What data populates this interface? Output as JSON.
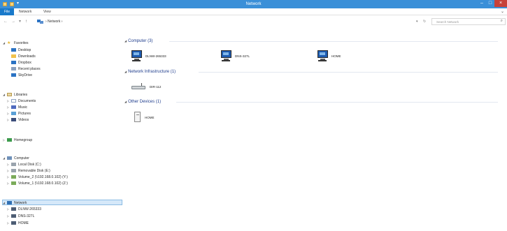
{
  "window": {
    "title": "Network",
    "qat": [
      "▾"
    ],
    "controls": {
      "minimize": "–",
      "maximize": "□",
      "close": "×"
    }
  },
  "ribbon": {
    "tabs": [
      {
        "label": "File"
      },
      {
        "label": "Network"
      },
      {
        "label": "View"
      }
    ],
    "expand": "⌄"
  },
  "addressbar": {
    "back": "←",
    "forward": "→",
    "recent": "▾",
    "up": "↑",
    "breadcrumb": "› Network ›",
    "dropdown": "▾",
    "refresh": "↻",
    "search_placeholder": "Search Network",
    "search_icon": "⌕"
  },
  "navpane": {
    "items": [
      {
        "label": "Favorites",
        "arrow": "◢",
        "icon": "star-icon"
      },
      {
        "label": "Desktop",
        "icon": "desktop-icon"
      },
      {
        "label": "Downloads",
        "icon": "downloads-icon"
      },
      {
        "label": "Dropbox",
        "icon": "dropbox-icon"
      },
      {
        "label": "Recent places",
        "icon": "recent-places-icon"
      },
      {
        "label": "SkyDrive",
        "icon": "skydrive-icon"
      },
      {
        "label": "Libraries",
        "arrow": "◢",
        "icon": "libraries-icon"
      },
      {
        "label": "Documents",
        "arrow": "▷",
        "icon": "documents-icon"
      },
      {
        "label": "Music",
        "arrow": "▷",
        "icon": "music-icon"
      },
      {
        "label": "Pictures",
        "arrow": "▷",
        "icon": "pictures-icon"
      },
      {
        "label": "Videos",
        "arrow": "▷",
        "icon": "videos-icon"
      },
      {
        "label": "Homegroup",
        "arrow": "▷",
        "icon": "homegroup-icon"
      },
      {
        "label": "Computer",
        "arrow": "◢",
        "icon": "computer-icon"
      },
      {
        "label": "Local Disk (C:)",
        "arrow": "▷",
        "icon": "disk-icon"
      },
      {
        "label": "Removable Disk (E:)",
        "arrow": "▷",
        "icon": "removable-disk-icon"
      },
      {
        "label": "Volume_2 (\\\\192.168.0.102) (Y:)",
        "arrow": "▷",
        "icon": "network-drive-icon"
      },
      {
        "label": "Volume_1 (\\\\192.168.0.102) (Z:)",
        "arrow": "▷",
        "icon": "network-drive-icon"
      },
      {
        "label": "Network",
        "arrow": "◢",
        "icon": "network-icon",
        "selected": true
      },
      {
        "label": "DLNW-265333",
        "arrow": "▷",
        "icon": "network-computer-icon"
      },
      {
        "label": "DNS-327L",
        "arrow": "▷",
        "icon": "network-computer-icon"
      },
      {
        "label": "HOME",
        "arrow": "▷",
        "icon": "network-computer-icon"
      }
    ]
  },
  "content": {
    "groups": [
      {
        "header": "Computer (3)",
        "caret": "◢",
        "items": [
          "DLNW-265333",
          "DNS-327L",
          "HOME"
        ]
      },
      {
        "header": "Network Infrastructure (1)",
        "caret": "◢",
        "items": [
          "DIR-112"
        ]
      },
      {
        "header": "Other Devices (1)",
        "caret": "◢",
        "items": [
          "HOME"
        ]
      }
    ]
  },
  "colors": {
    "titlebar": "#3a8fd8",
    "file_tab": "#1979ca",
    "close_button": "#c7413a",
    "group_header_text": "#1e3c8c",
    "selected_item_bg": "#d5e8f9"
  }
}
